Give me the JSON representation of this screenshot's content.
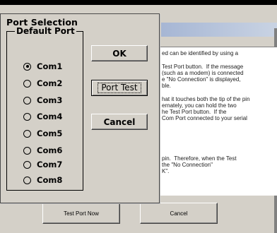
{
  "background_window": {
    "text_lines": [
      "ed can be identified by using a",
      "",
      "",
      "Test Port button.  If the message",
      "(such as a modem) is connected",
      "e \"No Connection\" is displayed,",
      "ble.",
      "hat it touches both the tip of the pin",
      "ernately, you can hold the two",
      "he Test Port button.  If the",
      "Com Port connected to your serial",
      "",
      "",
      "pin.  Therefore, when the Test",
      "the \"No Connection\"",
      "K\"."
    ],
    "test_port_now_label": "Test Port Now",
    "cancel_label": "Cancel"
  },
  "dialog": {
    "title": "Port Selection",
    "group_label": "Default Port",
    "ports": [
      {
        "label": "Com1",
        "checked": true
      },
      {
        "label": "Com2",
        "checked": false
      },
      {
        "label": "Com3",
        "checked": false
      },
      {
        "label": "Com4",
        "checked": false
      },
      {
        "label": "Com5",
        "checked": false
      },
      {
        "label": "Com6",
        "checked": false
      },
      {
        "label": "Com7",
        "checked": false
      },
      {
        "label": "Com8",
        "checked": false
      }
    ],
    "ok_label": "OK",
    "port_test_label": "Port Test",
    "cancel_label": "Cancel"
  },
  "colors": {
    "dialog_face": "#d4d0c8",
    "top_bar": "#000000",
    "title_gradient_start": "#a6b6d4"
  }
}
